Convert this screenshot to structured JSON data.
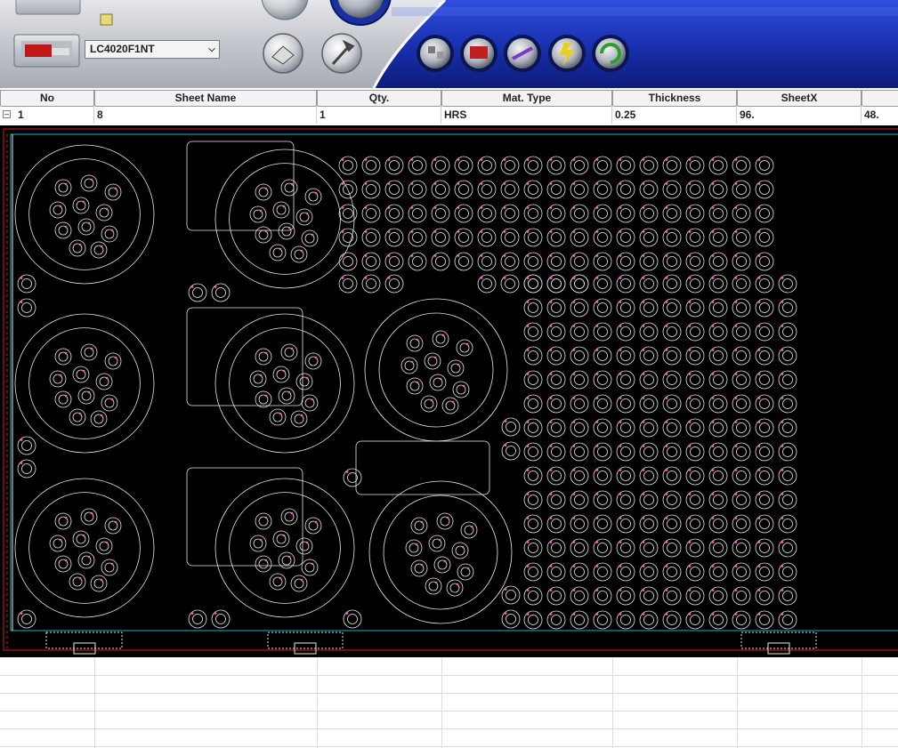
{
  "toolbar": {
    "machine": {
      "selected": "LC4020F1NT"
    },
    "buttons": [
      {
        "name": "properties-button",
        "icon": "page-icon"
      },
      {
        "name": "tools-button",
        "icon": "wrench-icon"
      },
      {
        "name": "parts-button",
        "icon": "parts-icon"
      },
      {
        "name": "machine-button",
        "icon": "machine-icon"
      },
      {
        "name": "nesting-button",
        "icon": "nesting-icon"
      },
      {
        "name": "process-button",
        "icon": "lightning-icon"
      },
      {
        "name": "refresh-button",
        "icon": "recycle-icon"
      }
    ]
  },
  "sheet_table": {
    "columns": [
      "No",
      "Sheet Name",
      "Qty.",
      "Mat. Type",
      "Thickness",
      "SheetX",
      ""
    ],
    "rows": [
      [
        "1",
        "8",
        "1",
        "HRS",
        "0.25",
        "96.",
        "48."
      ]
    ]
  },
  "colors": {
    "accent_blue": "#1c36b8",
    "toolbar_silver": "#c9ccd2",
    "nest_background": "#000000",
    "part_line": "#e8e8e8",
    "sheet_border_cyan": "#19b6c8",
    "sheet_border_red": "#d42020",
    "pierce_point": "#ff5ac8"
  }
}
